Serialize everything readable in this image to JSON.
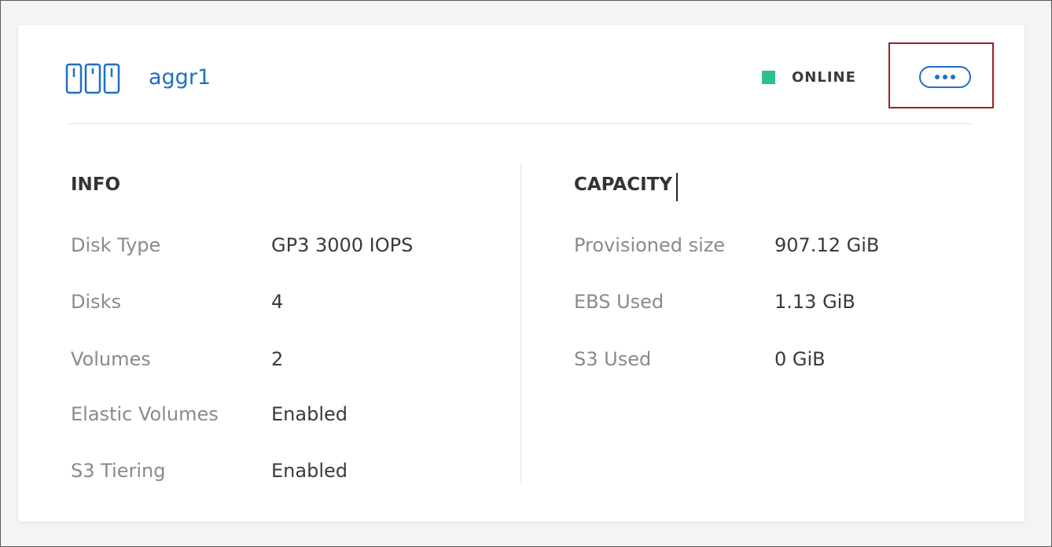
{
  "aggregate": {
    "name": "aggr1",
    "status": "ONLINE",
    "status_color": "#2fbf8f",
    "accent_color": "#1f6fc4",
    "icon": "aggregate-disks-icon",
    "actions_icon": "more-horizontal-icon"
  },
  "info": {
    "title": "INFO",
    "rows": [
      {
        "label": "Disk Type",
        "value": "GP3 3000 IOPS"
      },
      {
        "label": "Disks",
        "value": "4"
      },
      {
        "label": "Volumes",
        "value": "2"
      },
      {
        "label": "Elastic Volumes",
        "value": "Enabled"
      },
      {
        "label": "S3 Tiering",
        "value": "Enabled"
      }
    ]
  },
  "capacity": {
    "title": "CAPACITY",
    "rows": [
      {
        "label": "Provisioned size",
        "value": "907.12 GiB"
      },
      {
        "label": "EBS Used",
        "value": "1.13 GiB"
      },
      {
        "label": "S3 Used",
        "value": "0 GiB"
      }
    ]
  }
}
